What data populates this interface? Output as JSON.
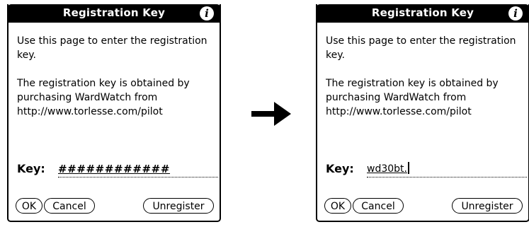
{
  "before": {
    "title": "Registration Key",
    "info_icon": "info-icon",
    "intro_text": "Use this page to enter the registration key.",
    "body_text": "The registration key is obtained by purchasing WardWatch from http://www.torlesse.com/pilot",
    "key_label": "Key:",
    "key_value": "############",
    "buttons": {
      "ok": "OK",
      "cancel": "Cancel",
      "unregister": "Unregister"
    }
  },
  "after": {
    "title": "Registration Key",
    "info_icon": "info-icon",
    "intro_text": "Use this page to enter the registration key.",
    "body_text": "The registration key is obtained by purchasing WardWatch from http://www.torlesse.com/pilot",
    "key_label": "Key:",
    "key_value": "wd30bt.",
    "buttons": {
      "ok": "OK",
      "cancel": "Cancel",
      "unregister": "Unregister"
    }
  },
  "arrow_icon": "right-arrow-icon"
}
